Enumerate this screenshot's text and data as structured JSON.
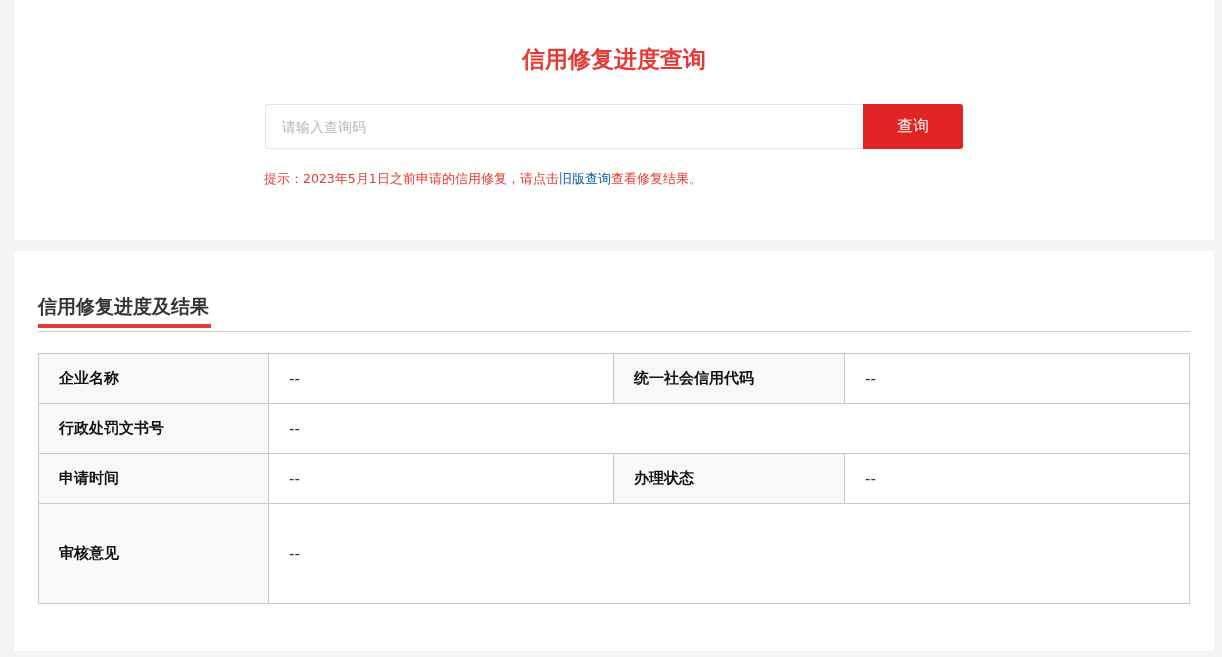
{
  "search": {
    "title": "信用修复进度查询",
    "placeholder": "请输入查询码",
    "button": "查询",
    "hint": {
      "prefix": "提示：2023年5月1日之前申请的信用修复，请点击",
      "link": "旧版查询",
      "suffix": "查看修复结果。"
    }
  },
  "results": {
    "title": "信用修复进度及结果",
    "rows": [
      {
        "kind": "normal",
        "cells": [
          {
            "label": "企业名称",
            "value": "--"
          },
          {
            "label": "统一社会信用代码",
            "value": "--"
          }
        ]
      },
      {
        "kind": "normal",
        "cells": [
          {
            "label": "行政处罚文书号",
            "value": "--"
          }
        ]
      },
      {
        "kind": "normal",
        "cells": [
          {
            "label": "申请时间",
            "value": "--"
          },
          {
            "label": "办理状态",
            "value": "--"
          }
        ]
      },
      {
        "kind": "tall",
        "cells": [
          {
            "label": "审核意见",
            "value": "--"
          }
        ]
      }
    ]
  }
}
